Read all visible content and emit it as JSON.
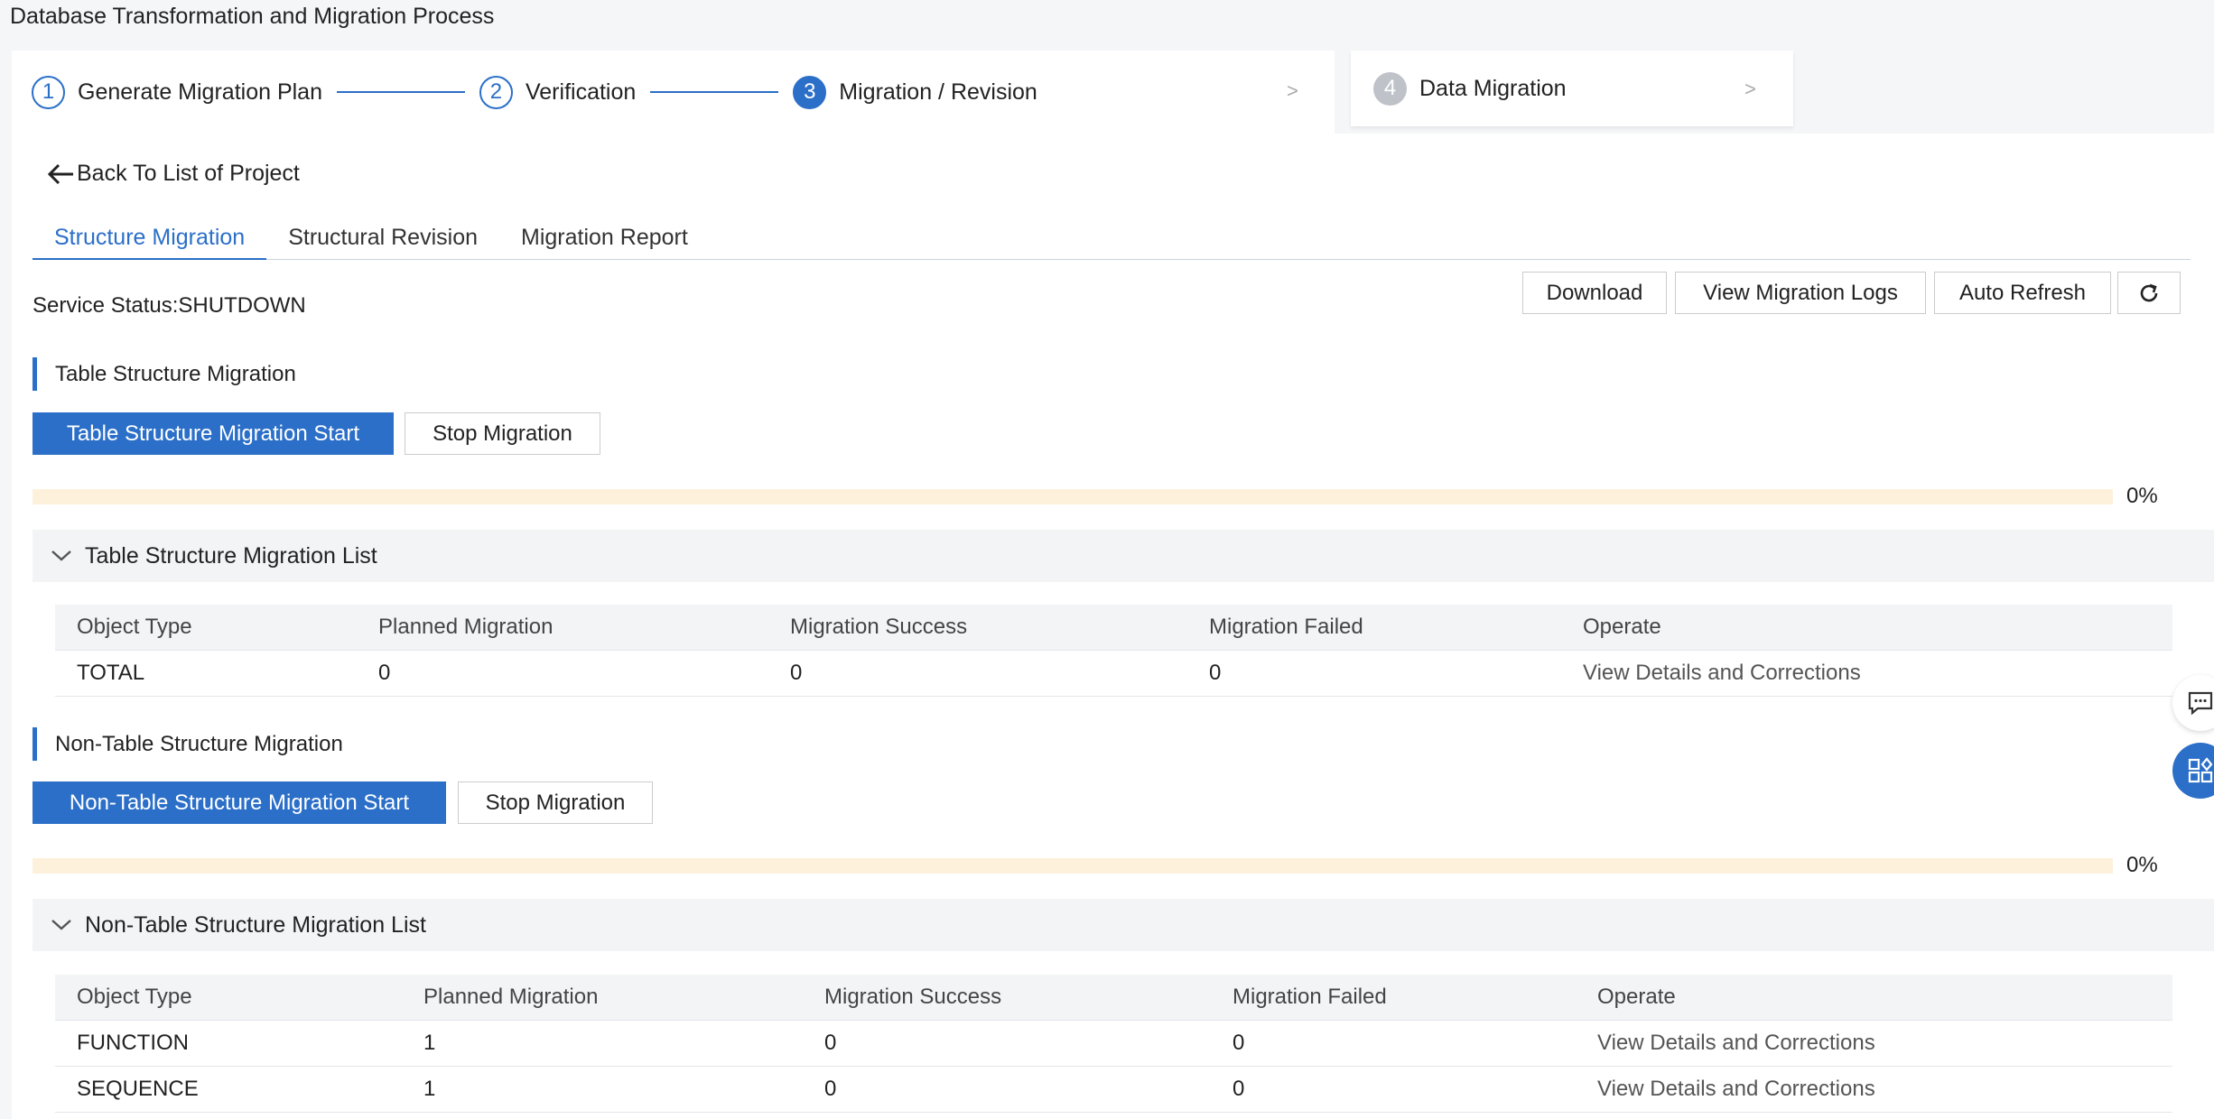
{
  "page_title": "Database Transformation and Migration Process",
  "steps": [
    {
      "num": "1",
      "label": "Generate Migration Plan"
    },
    {
      "num": "2",
      "label": "Verification"
    },
    {
      "num": "3",
      "label": "Migration / Revision"
    },
    {
      "num": "4",
      "label": "Data Migration"
    }
  ],
  "step_arrow": ">",
  "back_label": "Back To List of Project",
  "tabs": [
    "Structure Migration",
    "Structural Revision",
    "Migration Report"
  ],
  "service_status": "Service Status:SHUTDOWN",
  "toolbar": {
    "download": "Download",
    "view_logs": "View Migration Logs",
    "auto_refresh": "Auto Refresh"
  },
  "table_section": {
    "title": "Table Structure Migration",
    "start_label": "Table Structure Migration Start",
    "stop_label": "Stop Migration",
    "progress_percent": 0,
    "progress_label": "0%",
    "list_title": "Table Structure Migration List",
    "columns": [
      "Object Type",
      "Planned Migration",
      "Migration Success",
      "Migration Failed",
      "Operate"
    ],
    "rows": [
      {
        "type": "TOTAL",
        "planned": "0",
        "success": "0",
        "failed": "0",
        "operate": "View Details and Corrections"
      }
    ]
  },
  "non_table_section": {
    "title": "Non-Table Structure Migration",
    "start_label": "Non-Table Structure Migration Start",
    "stop_label": "Stop Migration",
    "progress_percent": 0,
    "progress_label": "0%",
    "list_title": "Non-Table Structure Migration List",
    "columns": [
      "Object Type",
      "Planned Migration",
      "Migration Success",
      "Migration Failed",
      "Operate"
    ],
    "rows": [
      {
        "type": "FUNCTION",
        "planned": "1",
        "success": "0",
        "failed": "0",
        "operate": "View Details and Corrections"
      },
      {
        "type": "SEQUENCE",
        "planned": "1",
        "success": "0",
        "failed": "0",
        "operate": "View Details and Corrections"
      }
    ]
  },
  "colors": {
    "accent": "#2b6fc8",
    "progress_track": "#fdf1dc"
  }
}
